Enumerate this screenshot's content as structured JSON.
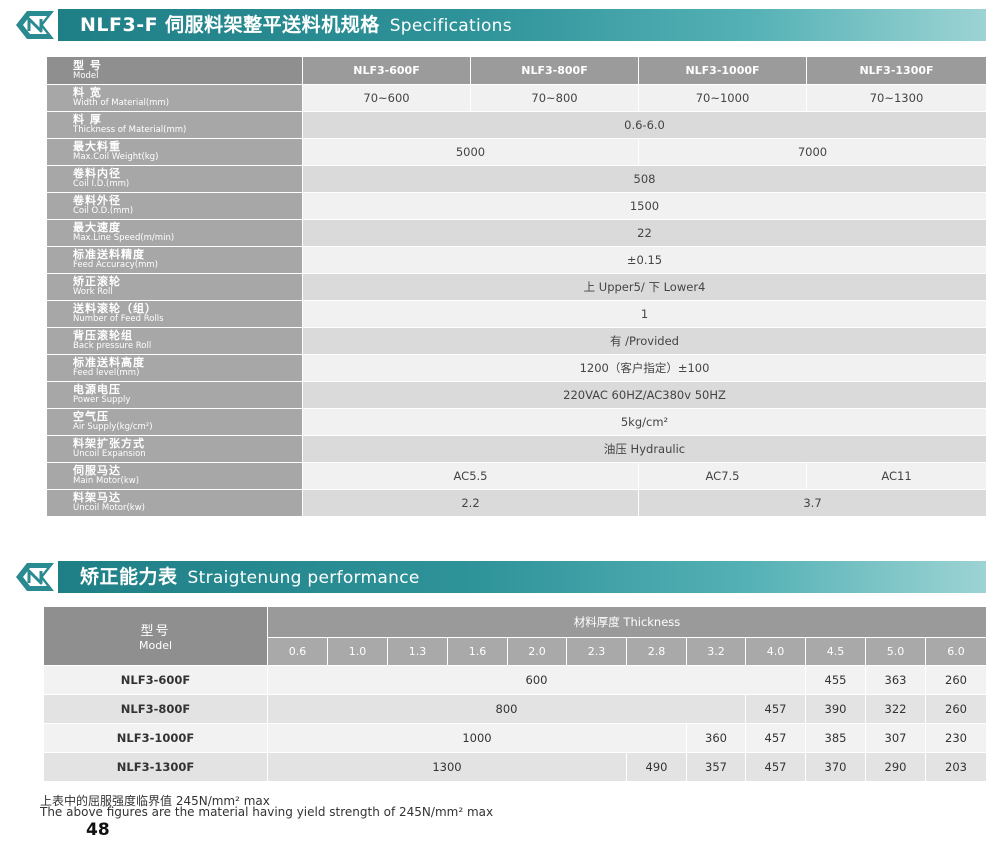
{
  "section1": {
    "title_cn": "NLF3-F 伺服料架整平送料机规格",
    "title_en": "Specifications"
  },
  "spec": {
    "header": {
      "label_cn": "型 号",
      "label_en": "Model",
      "models": [
        "NLF3-600F",
        "NLF3-800F",
        "NLF3-1000F",
        "NLF3-1300F"
      ]
    },
    "rows": [
      {
        "cn": "料 宽",
        "en": "Width of Material(mm)",
        "cells": [
          {
            "text": "70~600",
            "span": 1
          },
          {
            "text": "70~800",
            "span": 1
          },
          {
            "text": "70~1000",
            "span": 1
          },
          {
            "text": "70~1300",
            "span": 1
          }
        ]
      },
      {
        "cn": "料 厚",
        "en": "Thickness of Material(mm)",
        "cells": [
          {
            "text": "0.6-6.0",
            "span": 4
          }
        ]
      },
      {
        "cn": "最大料重",
        "en": "Max.Coil Weight(kg)",
        "cells": [
          {
            "text": "5000",
            "span": 2
          },
          {
            "text": "7000",
            "span": 2
          }
        ]
      },
      {
        "cn": "卷料内径",
        "en": "Coil I.D.(mm)",
        "cells": [
          {
            "text": "508",
            "span": 4
          }
        ]
      },
      {
        "cn": "卷料外径",
        "en": "Coil O.D.(mm)",
        "cells": [
          {
            "text": "1500",
            "span": 4
          }
        ]
      },
      {
        "cn": "最大速度",
        "en": "Max.Line Speed(m/min)",
        "cells": [
          {
            "text": "22",
            "span": 4
          }
        ]
      },
      {
        "cn": "标准送料精度",
        "en": "Feed Accuracy(mm)",
        "cells": [
          {
            "text": "±0.15",
            "span": 4
          }
        ]
      },
      {
        "cn": "矫正滚轮",
        "en": "Work Roll",
        "cells": [
          {
            "text": "上 Upper5/ 下 Lower4",
            "span": 4
          }
        ]
      },
      {
        "cn": "送料滚轮（组）",
        "en": "Number of Feed Rolls",
        "cells": [
          {
            "text": "1",
            "span": 4
          }
        ]
      },
      {
        "cn": "背压滚轮组",
        "en": "Back pressure Roll",
        "cells": [
          {
            "text": "有 /Provided",
            "span": 4
          }
        ]
      },
      {
        "cn": "标准送料高度",
        "en": "Feed level(mm)",
        "cells": [
          {
            "text": "1200（客户指定）±100",
            "span": 4
          }
        ]
      },
      {
        "cn": "电源电压",
        "en": "Power Supply",
        "cells": [
          {
            "text": "220VAC 60HZ/AC380v 50HZ",
            "span": 4
          }
        ]
      },
      {
        "cn": "空气压",
        "en": "Air Supply(kg/cm²)",
        "cells": [
          {
            "text": "5kg/cm²",
            "span": 4
          }
        ]
      },
      {
        "cn": "料架扩张方式",
        "en": "Uncoil Expansion",
        "cells": [
          {
            "text": "油压 Hydraulic",
            "span": 4
          }
        ]
      },
      {
        "cn": "伺服马达",
        "en": "Main Motor(kw)",
        "cells": [
          {
            "text": "AC5.5",
            "span": 2
          },
          {
            "text": "AC7.5",
            "span": 1
          },
          {
            "text": "AC11",
            "span": 1
          }
        ]
      },
      {
        "cn": "料架马达",
        "en": "Uncoil Motor(kw)",
        "cells": [
          {
            "text": "2.2",
            "span": 2
          },
          {
            "text": "3.7",
            "span": 2
          }
        ]
      }
    ]
  },
  "section2": {
    "title_cn": "矫正能力表",
    "title_en": "Straigtenung performance"
  },
  "perf": {
    "model_cn": "型号",
    "model_en": "Model",
    "thickness_label": "材料厚度 Thickness",
    "thicknesses": [
      "0.6",
      "1.0",
      "1.3",
      "1.6",
      "2.0",
      "2.3",
      "2.8",
      "3.2",
      "4.0",
      "4.5",
      "5.0",
      "6.0"
    ],
    "rows": [
      {
        "model": "NLF3-600F",
        "cells": [
          {
            "text": "600",
            "span": 9
          },
          {
            "text": "455",
            "span": 1
          },
          {
            "text": "363",
            "span": 1
          },
          {
            "text": "260",
            "span": 1
          }
        ]
      },
      {
        "model": "NLF3-800F",
        "cells": [
          {
            "text": "800",
            "span": 8
          },
          {
            "text": "457",
            "span": 1
          },
          {
            "text": "390",
            "span": 1
          },
          {
            "text": "322",
            "span": 1
          },
          {
            "text": "260",
            "span": 1
          }
        ]
      },
      {
        "model": "NLF3-1000F",
        "cells": [
          {
            "text": "1000",
            "span": 7
          },
          {
            "text": "360",
            "span": 1
          },
          {
            "text": "457",
            "span": 1
          },
          {
            "text": "385",
            "span": 1
          },
          {
            "text": "307",
            "span": 1
          },
          {
            "text": "230",
            "span": 1
          }
        ]
      },
      {
        "model": "NLF3-1300F",
        "cells": [
          {
            "text": "1300",
            "span": 6
          },
          {
            "text": "490",
            "span": 1
          },
          {
            "text": "357",
            "span": 1
          },
          {
            "text": "457",
            "span": 1
          },
          {
            "text": "370",
            "span": 1
          },
          {
            "text": "290",
            "span": 1
          },
          {
            "text": "203",
            "span": 1
          }
        ]
      }
    ]
  },
  "notes": {
    "cn": "上表中的屈服强度临界值 245N/mm² max",
    "en": "The above figures are the material having yield strength of 245N/mm² max"
  },
  "page_number": "48"
}
